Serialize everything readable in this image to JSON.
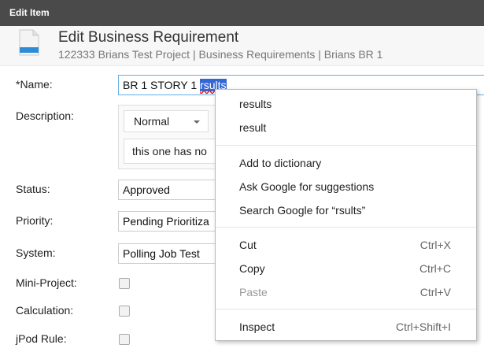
{
  "window": {
    "title": "Edit Item"
  },
  "header": {
    "title": "Edit Business Requirement",
    "breadcrumb": "122333 Brians Test Project | Business Requirements | Brians BR 1"
  },
  "form": {
    "name_label": "*Name:",
    "name_value_prefix": "BR 1 STORY 1 ",
    "name_value_selected": "rsults",
    "description_label": "Description:",
    "format_value": "Normal",
    "description_text": "this one has no",
    "status_label": "Status:",
    "status_value": "Approved",
    "priority_label": "Priority:",
    "priority_value": "Pending Prioritiza",
    "system_label": "System:",
    "system_value": "Polling Job Test",
    "mini_project_label": "Mini-Project:",
    "calculation_label": "Calculation:",
    "jpod_rule_label": "jPod Rule:"
  },
  "context_menu": {
    "suggestions": [
      "results",
      "result"
    ],
    "add_dictionary": "Add to dictionary",
    "ask_google": "Ask Google for suggestions",
    "search_google": "Search Google for “rsults”",
    "cut": "Cut",
    "cut_shortcut": "Ctrl+X",
    "copy": "Copy",
    "copy_shortcut": "Ctrl+C",
    "paste": "Paste",
    "paste_shortcut": "Ctrl+V",
    "inspect": "Inspect",
    "inspect_shortcut": "Ctrl+Shift+I"
  },
  "colors": {
    "title_bar": "#4a4a4a",
    "selection": "#3367d6",
    "icon_accent": "#2e8bd6"
  },
  "icons": [
    "document-icon",
    "dropdown-caret-icon"
  ]
}
